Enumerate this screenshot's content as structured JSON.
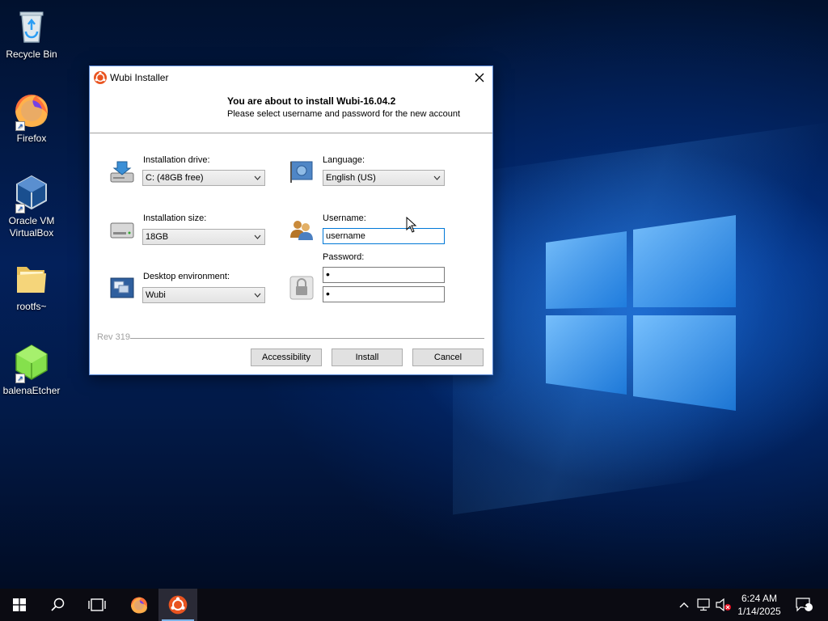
{
  "desktop": {
    "icons": [
      {
        "label": "Recycle Bin"
      },
      {
        "label": "Firefox"
      },
      {
        "label": "Oracle VM\nVirtualBox"
      },
      {
        "label": "rootfs~"
      },
      {
        "label": "balenaEtcher"
      }
    ]
  },
  "installer": {
    "title": "Wubi Installer",
    "heading": "You are about to install Wubi-16.04.2",
    "subheading": "Please select username and password for the new account",
    "installation_drive": {
      "label": "Installation drive:",
      "value": "C: (48GB free)"
    },
    "installation_size": {
      "label": "Installation size:",
      "value": "18GB"
    },
    "desktop_environment": {
      "label": "Desktop environment:",
      "value": "Wubi"
    },
    "language": {
      "label": "Language:",
      "value": "English (US)"
    },
    "username": {
      "label": "Username:",
      "value": "username"
    },
    "password": {
      "label": "Password:",
      "value": "•",
      "confirm_value": "•"
    },
    "rev": "Rev 319",
    "buttons": {
      "accessibility": "Accessibility",
      "install": "Install",
      "cancel": "Cancel"
    }
  },
  "taskbar": {
    "clock_time": "6:24 AM",
    "clock_date": "1/14/2025",
    "notification_count": "1"
  },
  "colors": {
    "accent": "#0078d7",
    "ubuntu_orange": "#e95420",
    "taskbar": "#0b0b12"
  }
}
